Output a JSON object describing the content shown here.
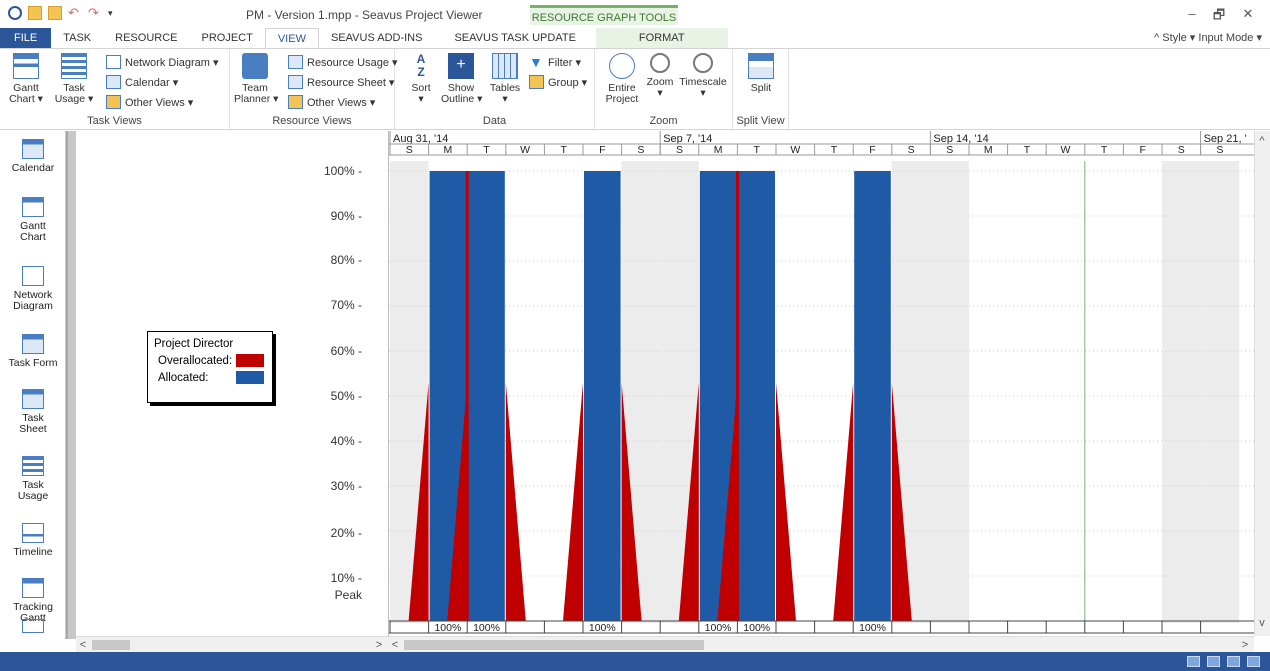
{
  "window": {
    "title": "PM - Version 1.mpp - Seavus Project Viewer",
    "context_title": "RESOURCE GRAPH TOOLS"
  },
  "tabs": {
    "file": "FILE",
    "task": "TASK",
    "resource": "RESOURCE",
    "project": "PROJECT",
    "view": "VIEW",
    "addins": "SEAVUS ADD-INS",
    "task_update": "SEAVUS TASK UPDATE",
    "format": "FORMAT",
    "right": "^ Style ▾ Input Mode ▾"
  },
  "ribbon": {
    "task_views": {
      "label": "Task Views",
      "gantt": "Gantt\nChart ▾",
      "task_usage": "Task\nUsage ▾",
      "network_diagram": "Network Diagram ▾",
      "calendar": "Calendar ▾",
      "other_views": "Other Views ▾"
    },
    "resource_views": {
      "label": "Resource Views",
      "team_planner": "Team\nPlanner ▾",
      "resource_usage": "Resource Usage ▾",
      "resource_sheet": "Resource Sheet ▾",
      "other_views": "Other Views ▾"
    },
    "data": {
      "label": "Data",
      "sort": "Sort\n▾",
      "outline": "Show\nOutline ▾",
      "tables": "Tables\n▾",
      "filter": "Filter ▾",
      "group": "Group ▾"
    },
    "zoom": {
      "label": "Zoom",
      "entire": "Entire\nProject",
      "zoom": "Zoom\n▾",
      "timescale": "Timescale\n▾"
    },
    "split_view": {
      "label": "Split View",
      "split": "Split"
    }
  },
  "viewbar": [
    {
      "label": "Calendar"
    },
    {
      "label": "Gantt\nChart"
    },
    {
      "label": "Network\nDiagram"
    },
    {
      "label": "Task Form"
    },
    {
      "label": "Task\nSheet"
    },
    {
      "label": "Task\nUsage"
    },
    {
      "label": "Timeline"
    },
    {
      "label": "Tracking\nGantt"
    }
  ],
  "legend": {
    "title": "Project Director",
    "overallocated": "Overallocated:",
    "allocated": "Allocated:"
  },
  "y_axis": [
    "100%",
    "90%",
    "80%",
    "70%",
    "60%",
    "50%",
    "40%",
    "30%",
    "20%",
    "10%",
    "Peak"
  ],
  "colors": {
    "allocated": "#1f5aa6",
    "overallocated": "#c00000",
    "nonworking": "#ececec",
    "accent": "#2b579a"
  },
  "chart_data": {
    "type": "bar",
    "title": "",
    "ylabel": "",
    "weeks": [
      "Aug 31, '14",
      "Sep 7, '14",
      "Sep 14, '14",
      "Sep 21, '"
    ],
    "days": [
      "S",
      "M",
      "T",
      "W",
      "T",
      "F",
      "S",
      "S",
      "M",
      "T",
      "W",
      "T",
      "F",
      "S",
      "S",
      "M",
      "T",
      "W",
      "T",
      "F",
      "S",
      "S"
    ],
    "allocated_pct": [
      0,
      100,
      100,
      0,
      0,
      100,
      0,
      0,
      100,
      100,
      0,
      0,
      100,
      0,
      0,
      0,
      0,
      0,
      0,
      0,
      0,
      0
    ],
    "overallocated_bars": [
      1,
      2,
      5,
      8,
      9,
      12
    ],
    "peak_labels": [
      "",
      "100%",
      "100%",
      "",
      "",
      "100%",
      "",
      "",
      "100%",
      "100%",
      "",
      "",
      "100%",
      "",
      "",
      "",
      "",
      "",
      "",
      "",
      "",
      ""
    ],
    "ylim": [
      0,
      100
    ]
  }
}
